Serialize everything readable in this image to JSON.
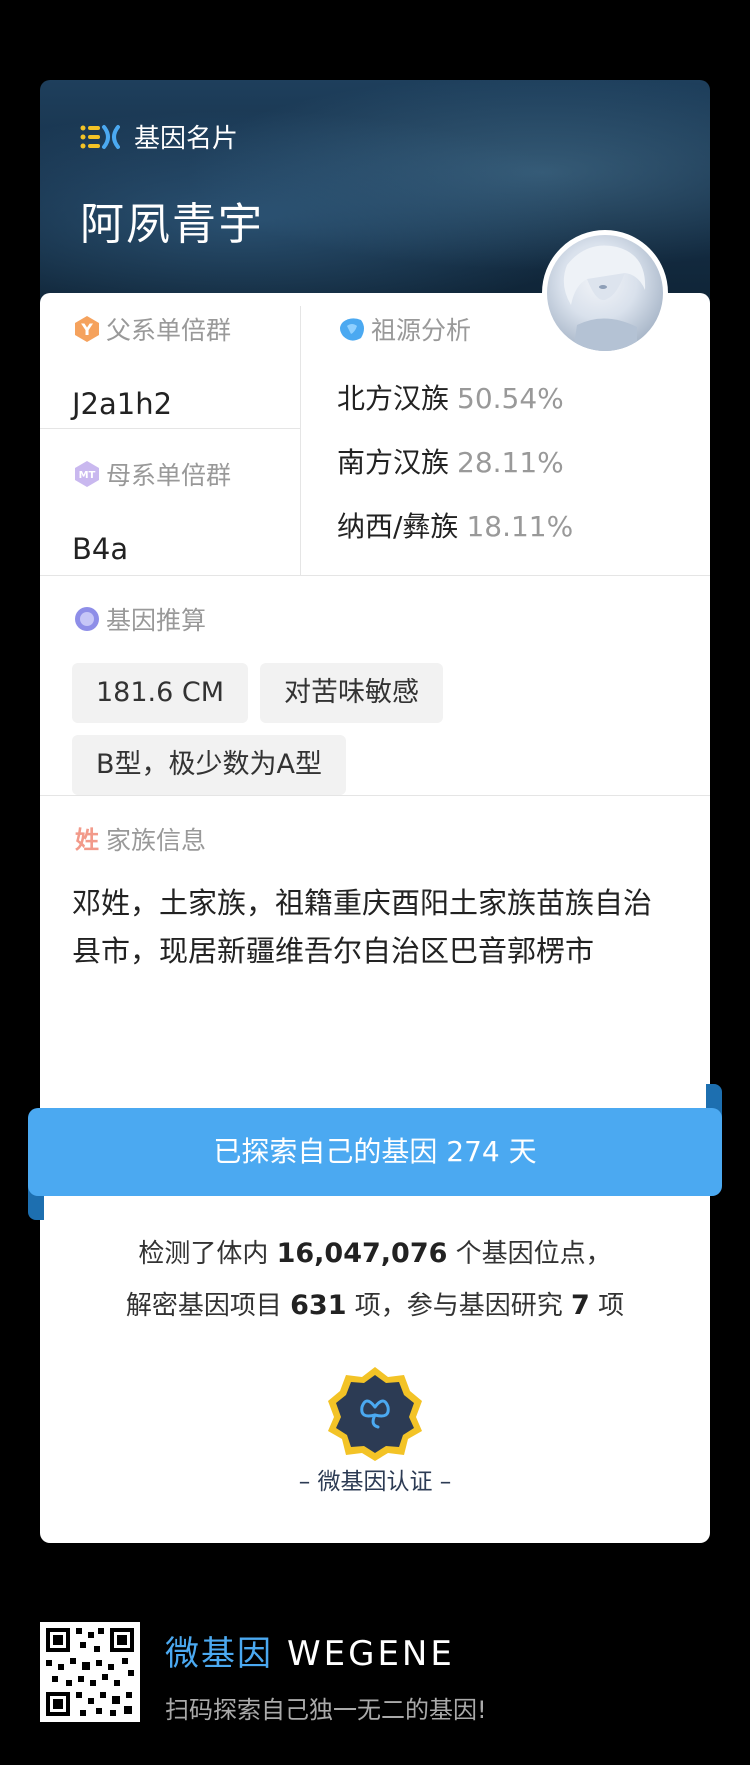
{
  "header": {
    "brand_label": "基因名片",
    "user_name": "阿夙青宇"
  },
  "paternal": {
    "title": "父系单倍群",
    "value": "J2a1h2"
  },
  "maternal": {
    "title": "母系单倍群",
    "value": "B4a"
  },
  "ancestry": {
    "title": "祖源分析",
    "rows": [
      {
        "name": "北方汉族",
        "pct": "50.54%"
      },
      {
        "name": "南方汉族",
        "pct": "28.11%"
      },
      {
        "name": "纳西/彝族",
        "pct": "18.11%"
      }
    ]
  },
  "traits": {
    "title": "基因推算",
    "tags": [
      "181.6 CM",
      "对苦味敏感",
      "B型，极少数为A型"
    ]
  },
  "family": {
    "title": "家族信息",
    "text": "邓姓，土家族，祖籍重庆酉阳土家族苗族自治县市，现居新疆维吾尔自治区巴音郭楞市"
  },
  "ribbon": {
    "text": "已探索自己的基因 274 天"
  },
  "stats": {
    "line1_prefix": "检测了体内 ",
    "loci": "16,047,076",
    "line1_suffix": " 个基因位点，",
    "line2_prefix": "解密基因项目 ",
    "projects": "631",
    "line2_mid": " 项，参与基因研究 ",
    "studies": "7",
    "line2_suffix": " 项"
  },
  "badge": {
    "label": "– 微基因认证 –"
  },
  "footer": {
    "brand_cn": "微基因",
    "brand_en": "WEGENE",
    "tagline": "扫码探索自己独一无二的基因!"
  },
  "colors": {
    "accent": "#4ba9f1",
    "ribbon_fold": "#1d6fb0",
    "badge_gold": "#f3c326",
    "badge_navy": "#2c3b54"
  }
}
